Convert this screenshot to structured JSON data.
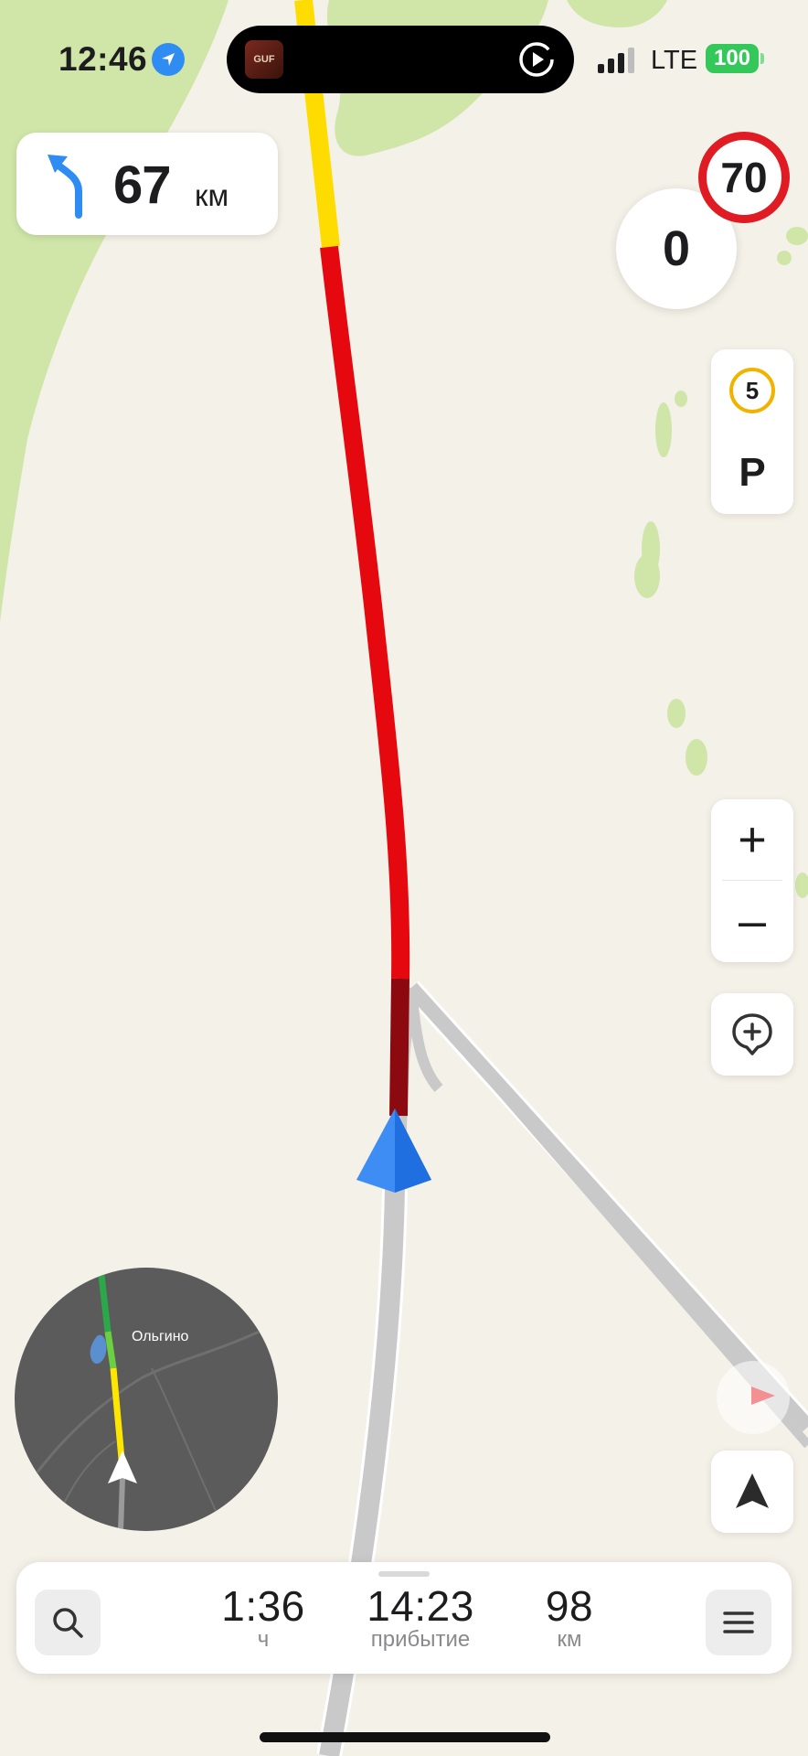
{
  "status_bar": {
    "time": "12:46",
    "network": "LTE",
    "battery": "100",
    "media_art_text": "GUF"
  },
  "maneuver": {
    "direction": "turn-left",
    "distance": "67",
    "unit": "км"
  },
  "speed": {
    "current": "0",
    "limit": "70"
  },
  "side_panel": {
    "points_badge": "5",
    "parking_label": "P",
    "zoom_in": "+",
    "zoom_out": "–"
  },
  "minimap": {
    "place_label": "Ольгино"
  },
  "bottom_bar": {
    "time_left": "1:36",
    "time_left_unit": "ч",
    "arrival": "14:23",
    "arrival_label": "прибытие",
    "distance": "98",
    "distance_unit": "км"
  },
  "colors": {
    "route_red": "#e5090f",
    "route_darkred": "#8c0a0f",
    "route_yellow": "#ffdc00",
    "route_green": "#5cc03c",
    "accent_blue": "#2f8cf2",
    "map_bg": "#f4f1e8",
    "forest": "#cfe6a8",
    "road_gray": "#c9c9c9"
  },
  "icons": [
    "location-arrow-icon",
    "play-icon",
    "turn-left-icon",
    "coin-icon",
    "zoom-in-icon",
    "zoom-out-icon",
    "add-road-event-icon",
    "north-arrow-icon",
    "search-icon",
    "menu-icon",
    "navigation-arrow-icon",
    "route-end-flag-icon"
  ]
}
